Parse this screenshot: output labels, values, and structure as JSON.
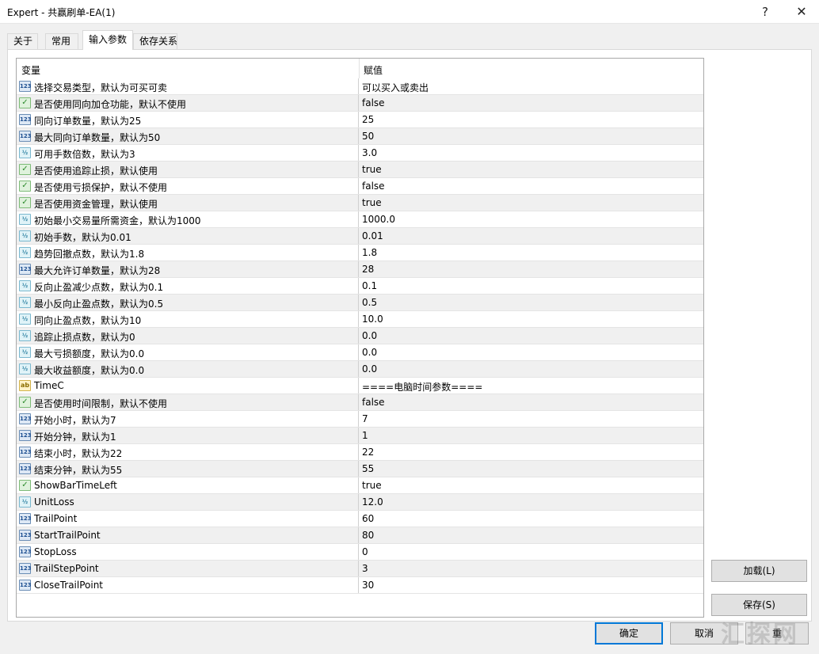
{
  "window": {
    "title": "Expert - 共赢刷单-EA(1)",
    "help_label": "?",
    "close_label": "✕"
  },
  "tabs": [
    {
      "label": "关于"
    },
    {
      "label": "常用"
    },
    {
      "label": "输入参数"
    },
    {
      "label": "依存关系"
    }
  ],
  "grid": {
    "col_variable": "变量",
    "col_value": "赋值",
    "rows": [
      {
        "type": "int",
        "name": "选择交易类型，默认为可买可卖",
        "value": "可以买入或卖出"
      },
      {
        "type": "bool",
        "name": "是否使用同向加仓功能，默认不使用",
        "value": "false"
      },
      {
        "type": "int",
        "name": "同向订单数量，默认为25",
        "value": "25"
      },
      {
        "type": "int",
        "name": "最大同向订单数量，默认为50",
        "value": "50"
      },
      {
        "type": "dbl",
        "name": "可用手数倍数，默认为3",
        "value": "3.0"
      },
      {
        "type": "bool",
        "name": "是否使用追踪止损，默认使用",
        "value": "true"
      },
      {
        "type": "bool",
        "name": "是否使用亏损保护，默认不使用",
        "value": "false"
      },
      {
        "type": "bool",
        "name": "是否使用资金管理，默认使用",
        "value": "true"
      },
      {
        "type": "dbl",
        "name": "初始最小交易量所需资金，默认为1000",
        "value": "1000.0"
      },
      {
        "type": "dbl",
        "name": "初始手数，默认为0.01",
        "value": "0.01"
      },
      {
        "type": "dbl",
        "name": "趋势回撤点数，默认为1.8",
        "value": "1.8"
      },
      {
        "type": "int",
        "name": "最大允许订单数量，默认为28",
        "value": "28"
      },
      {
        "type": "dbl",
        "name": "反向止盈减少点数，默认为0.1",
        "value": "0.1"
      },
      {
        "type": "dbl",
        "name": "最小反向止盈点数，默认为0.5",
        "value": "0.5"
      },
      {
        "type": "dbl",
        "name": "同向止盈点数，默认为10",
        "value": "10.0"
      },
      {
        "type": "dbl",
        "name": "追踪止损点数，默认为0",
        "value": "0.0"
      },
      {
        "type": "dbl",
        "name": "最大亏损额度，默认为0.0",
        "value": "0.0"
      },
      {
        "type": "dbl",
        "name": "最大收益额度，默认为0.0",
        "value": "0.0"
      },
      {
        "type": "str",
        "name": "TimeC",
        "value": "====电脑时间参数===="
      },
      {
        "type": "bool",
        "name": "是否使用时间限制，默认不使用",
        "value": "false"
      },
      {
        "type": "int",
        "name": "开始小时，默认为7",
        "value": "7"
      },
      {
        "type": "int",
        "name": "开始分钟，默认为1",
        "value": "1"
      },
      {
        "type": "int",
        "name": "结束小时，默认为22",
        "value": "22"
      },
      {
        "type": "int",
        "name": "结束分钟，默认为55",
        "value": "55"
      },
      {
        "type": "bool",
        "name": "ShowBarTimeLeft",
        "value": "true"
      },
      {
        "type": "dbl",
        "name": "UnitLoss",
        "value": "12.0"
      },
      {
        "type": "int",
        "name": "TrailPoint",
        "value": "60"
      },
      {
        "type": "int",
        "name": "StartTrailPoint",
        "value": "80"
      },
      {
        "type": "int",
        "name": "StopLoss",
        "value": "0"
      },
      {
        "type": "int",
        "name": "TrailStepPoint",
        "value": "3"
      },
      {
        "type": "int",
        "name": "CloseTrailPoint",
        "value": "30"
      }
    ]
  },
  "icon_glyphs": {
    "int": "123",
    "dbl": "½",
    "bool": "✓",
    "str": "ab"
  },
  "buttons": {
    "load": "加载(L)",
    "save": "保存(S)",
    "ok": "确定",
    "cancel": "取消",
    "reset": "重"
  },
  "watermark": "汇探网"
}
